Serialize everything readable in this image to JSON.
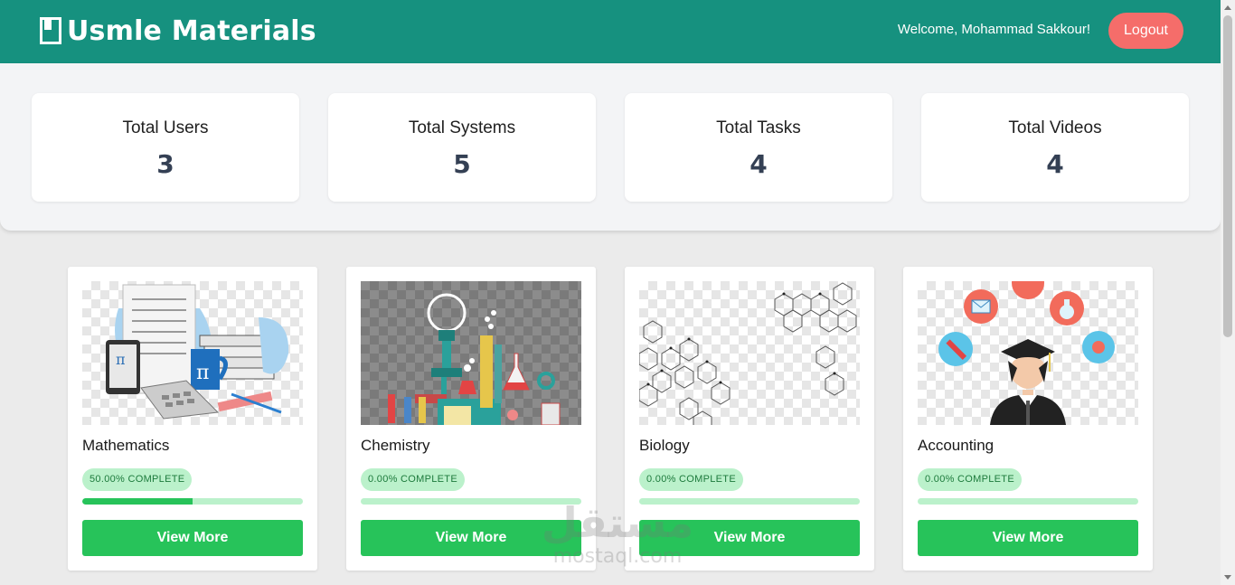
{
  "header": {
    "brand_title": "Usmle Materials",
    "brand_icon": "book-icon",
    "welcome_text": "Welcome, Mohammad Sakkour!",
    "logout_label": "Logout",
    "bar_color": "#16917f",
    "logout_color": "#f56d6a"
  },
  "stats": [
    {
      "label": "Total Users",
      "value": "3"
    },
    {
      "label": "Total Systems",
      "value": "5"
    },
    {
      "label": "Total Tasks",
      "value": "4"
    },
    {
      "label": "Total Videos",
      "value": "4"
    }
  ],
  "courses": [
    {
      "name": "Mathematics",
      "progress_text": "50.00% COMPLETE",
      "progress": 0.5,
      "button_label": "View More",
      "image": "mathematics-illustration"
    },
    {
      "name": "Chemistry",
      "progress_text": "0.00% COMPLETE",
      "progress": 0.0,
      "button_label": "View More",
      "image": "chemistry-illustration"
    },
    {
      "name": "Biology",
      "progress_text": "0.00% COMPLETE",
      "progress": 0.0,
      "button_label": "View More",
      "image": "biology-illustration"
    },
    {
      "name": "Accounting",
      "progress_text": "0.00% COMPLETE",
      "progress": 0.0,
      "button_label": "View More",
      "image": "accounting-illustration"
    }
  ],
  "colors": {
    "accent_green": "#27c35a",
    "badge_bg": "#bbf1cb",
    "badge_text": "#1d7a3c"
  },
  "watermark": {
    "arabic": "مستقل",
    "latin": "mostaql.com"
  }
}
